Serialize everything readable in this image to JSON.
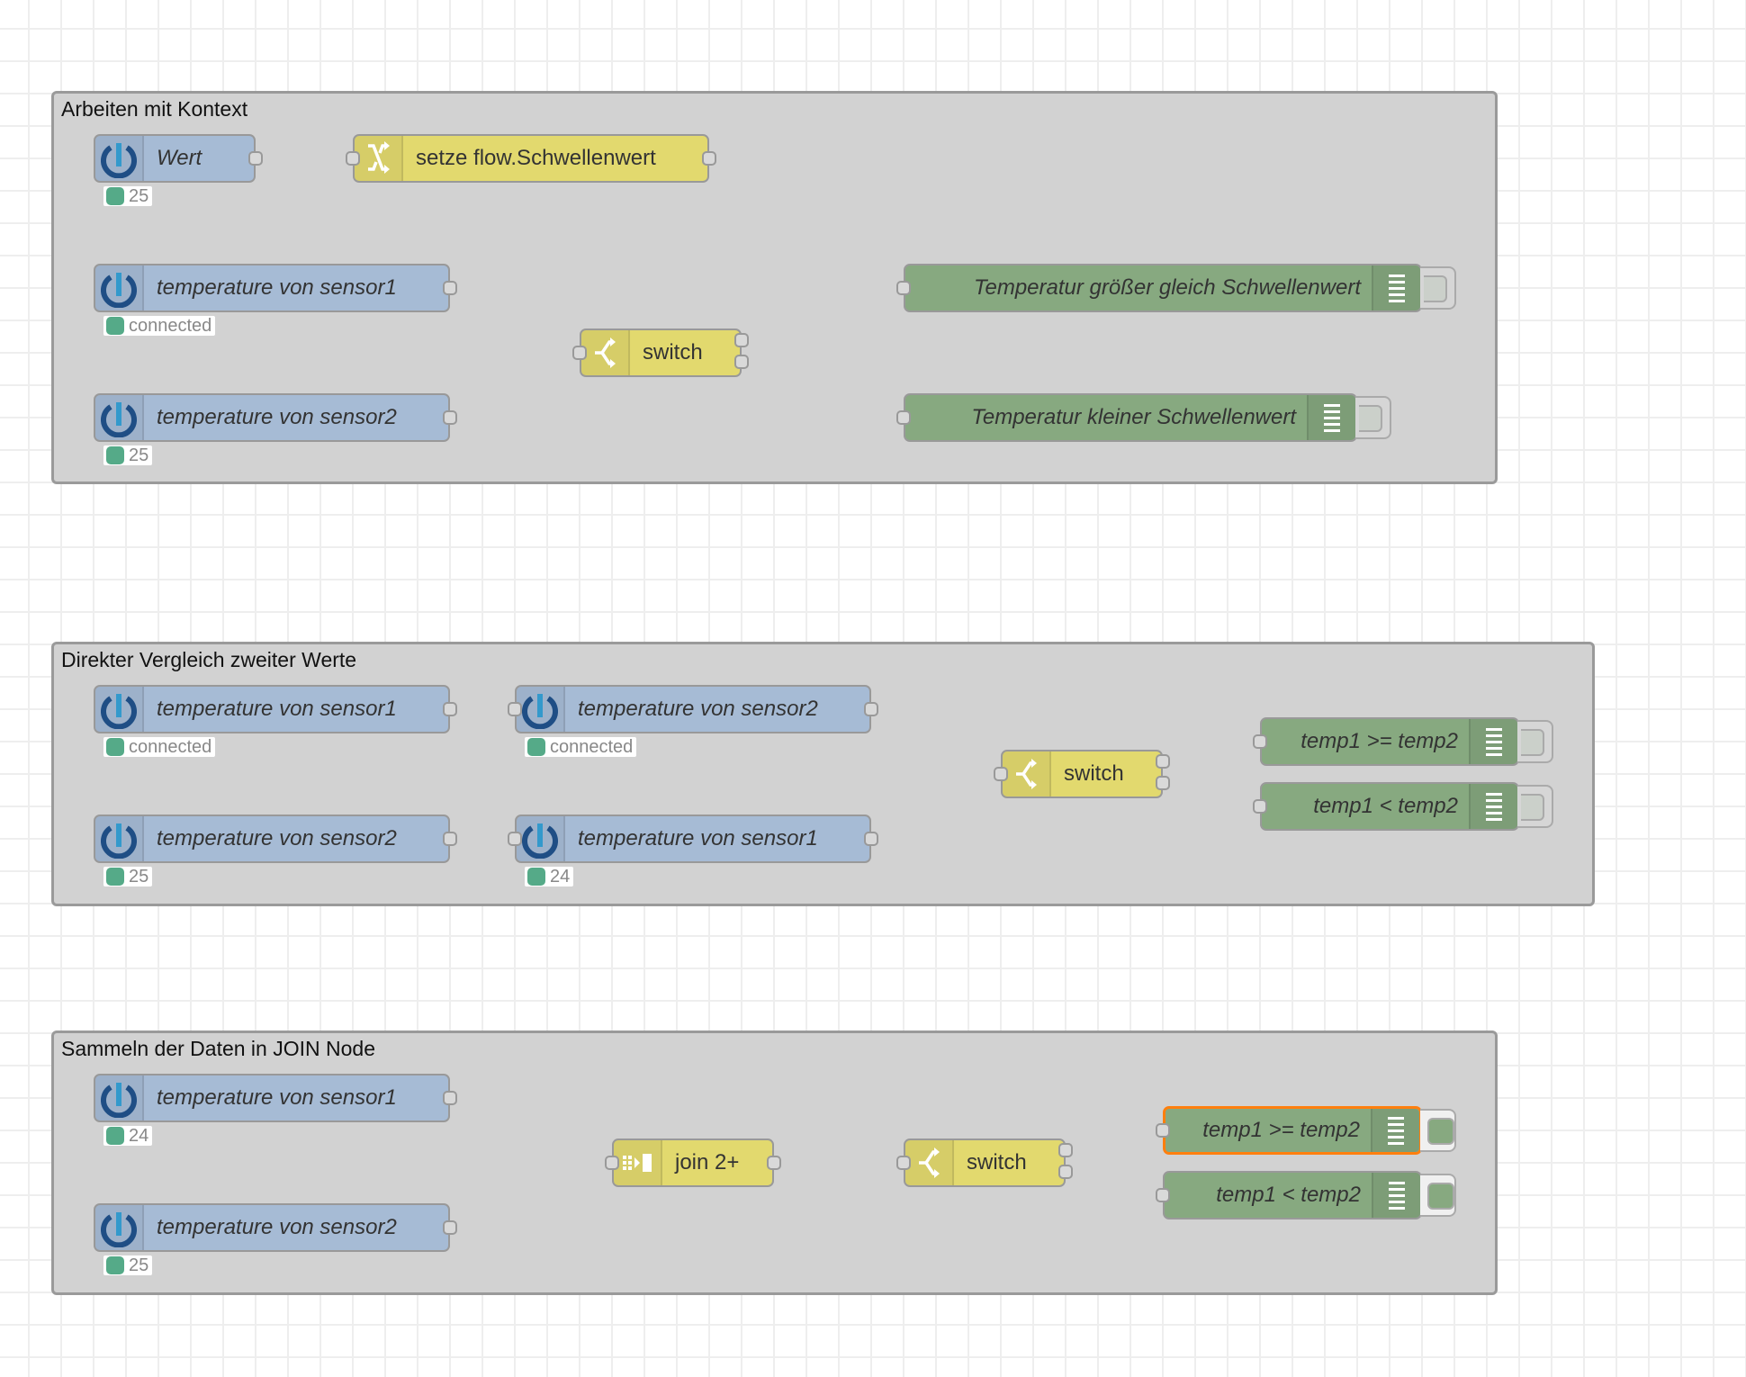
{
  "groups": [
    {
      "label": "Arbeiten mit Kontext",
      "nodes": {
        "wert": {
          "label": "Wert",
          "type": "inject",
          "icon": "iobroker-icon",
          "status": "25"
        },
        "setze": {
          "label": "setze flow.Schwellenwert",
          "type": "change",
          "icon": "shuffle-icon"
        },
        "sensor1": {
          "label": "temperature von sensor1",
          "type": "inject",
          "icon": "iobroker-icon",
          "status": "connected"
        },
        "sensor2": {
          "label": "temperature von sensor2",
          "type": "inject",
          "icon": "iobroker-icon",
          "status": "25"
        },
        "switch": {
          "label": "switch",
          "type": "switch",
          "icon": "switch-fork-icon"
        },
        "debug_ge": {
          "label": "Temperatur größer gleich Schwellenwert",
          "type": "debug",
          "icon": "debug-list-icon",
          "active": false
        },
        "debug_lt": {
          "label": "Temperatur kleiner Schwellenwert",
          "type": "debug",
          "icon": "debug-list-icon",
          "active": false
        }
      }
    },
    {
      "label": "Direkter Vergleich zweiter Werte",
      "nodes": {
        "a_sensor1": {
          "label": "temperature von sensor1",
          "type": "inject",
          "icon": "iobroker-icon",
          "status": "connected"
        },
        "a_sensor2": {
          "label": "temperature von sensor2",
          "type": "inject",
          "icon": "iobroker-icon",
          "status": "connected"
        },
        "b_sensor2": {
          "label": "temperature von sensor2",
          "type": "inject",
          "icon": "iobroker-icon",
          "status": "25"
        },
        "b_sensor1": {
          "label": "temperature von sensor1",
          "type": "inject",
          "icon": "iobroker-icon",
          "status": "24"
        },
        "switch": {
          "label": "switch",
          "type": "switch",
          "icon": "switch-fork-icon"
        },
        "debug_ge": {
          "label": "temp1 >= temp2",
          "type": "debug",
          "icon": "debug-list-icon",
          "active": false
        },
        "debug_lt": {
          "label": "temp1 < temp2",
          "type": "debug",
          "icon": "debug-list-icon",
          "active": false
        }
      }
    },
    {
      "label": "Sammeln der Daten in JOIN Node",
      "nodes": {
        "sensor1": {
          "label": "temperature von sensor1",
          "type": "inject",
          "icon": "iobroker-icon",
          "status": "24"
        },
        "sensor2": {
          "label": "temperature von sensor2",
          "type": "inject",
          "icon": "iobroker-icon",
          "status": "25"
        },
        "join": {
          "label": "join 2+",
          "type": "join",
          "icon": "join-icon"
        },
        "switch": {
          "label": "switch",
          "type": "switch",
          "icon": "switch-fork-icon"
        },
        "debug_ge": {
          "label": "temp1 >= temp2",
          "type": "debug",
          "icon": "debug-list-icon",
          "active": true,
          "selected": true
        },
        "debug_lt": {
          "label": "temp1 < temp2",
          "type": "debug",
          "icon": "debug-list-icon",
          "active": true
        }
      }
    }
  ],
  "colors": {
    "inject": "#a6bbd5",
    "function": "#e2d96e",
    "debug": "#87a980",
    "status_ok": "#55aa88",
    "selection": "#ff7f0e",
    "group_fill": "#d2d2d2",
    "wire": "#999999"
  }
}
